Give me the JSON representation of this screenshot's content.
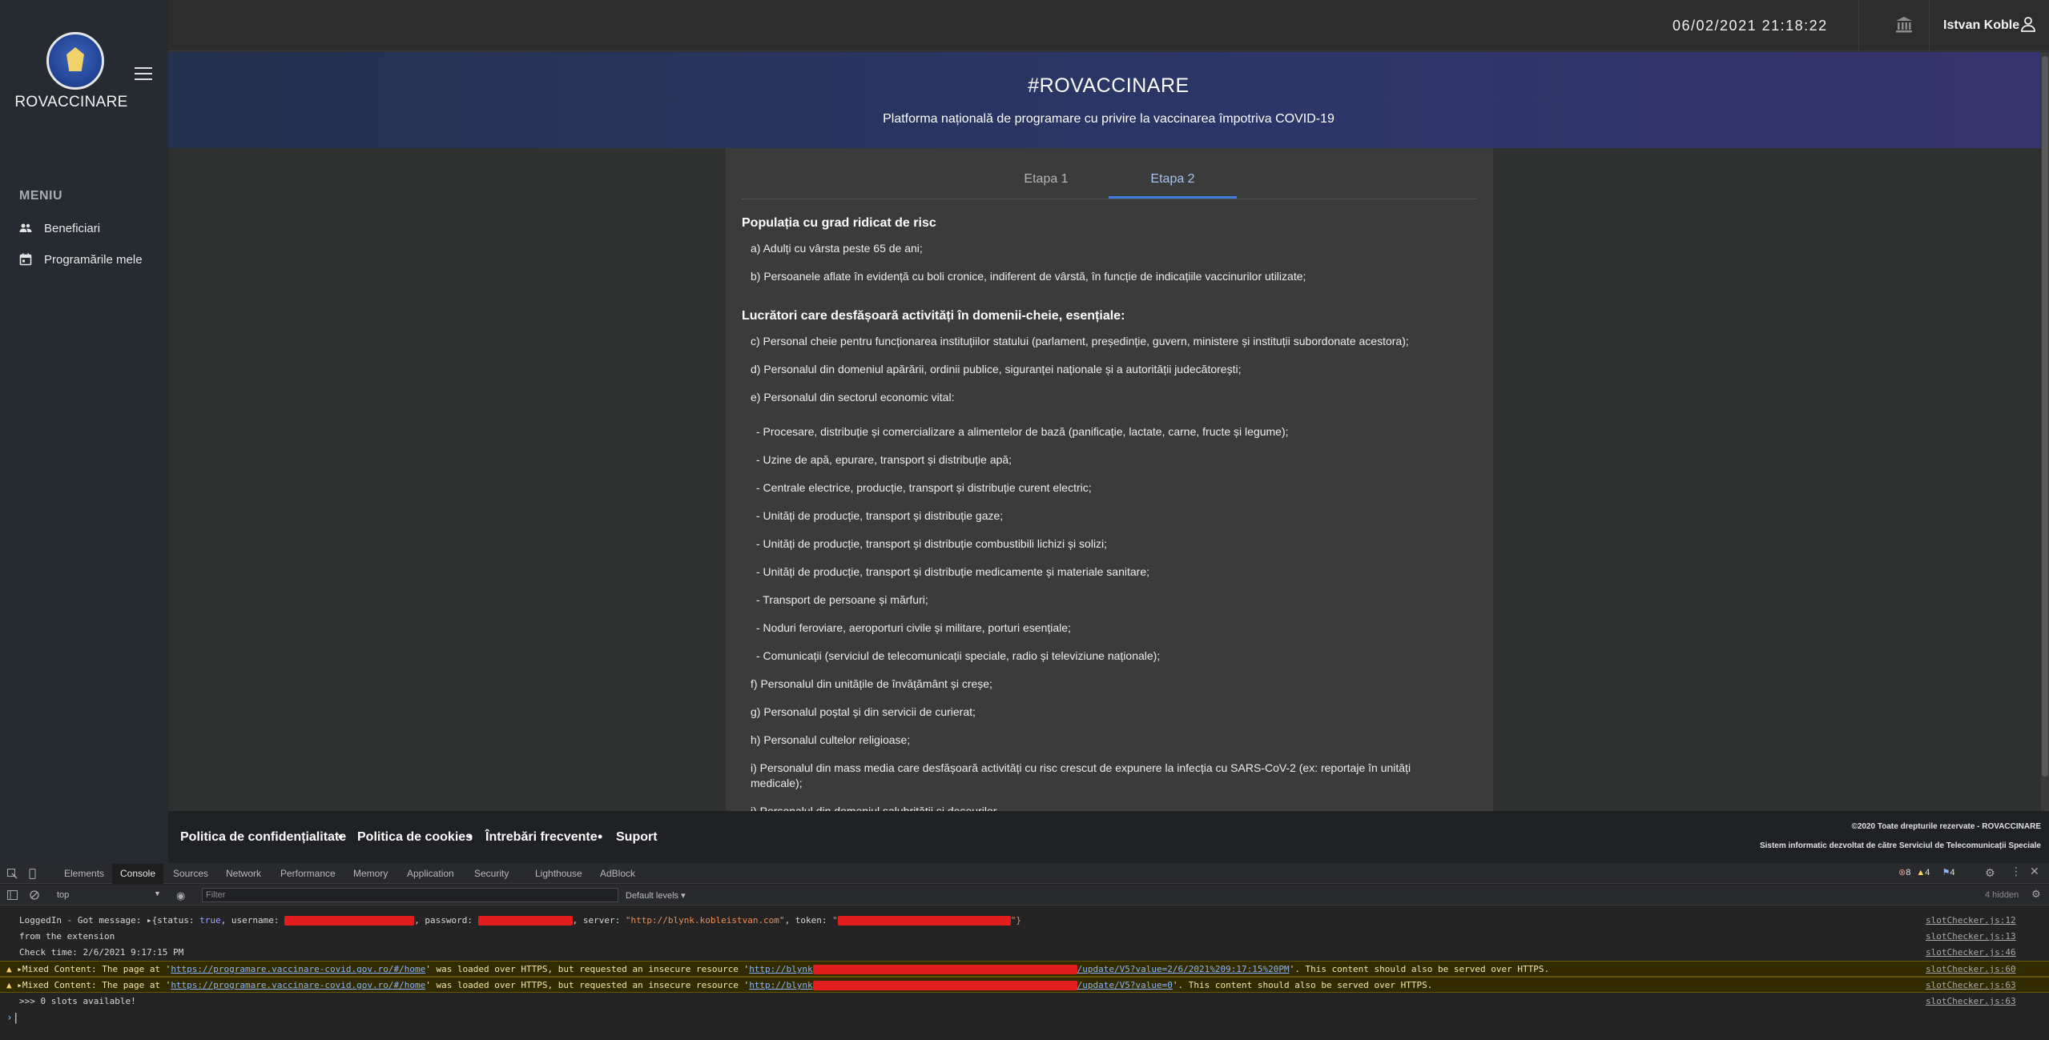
{
  "sidebar": {
    "brand": "ROVACCINARE",
    "menu_title": "MENIU",
    "items": [
      {
        "label": "Beneficiari",
        "icon": "users-icon"
      },
      {
        "label": "Programările mele",
        "icon": "calendar-icon"
      }
    ]
  },
  "topbar": {
    "datetime": "06/02/2021 21:18:22",
    "username": "Istvan Koble"
  },
  "banner": {
    "title": "#ROVACCINARE",
    "subtitle": "Platforma națională de programare cu privire la vaccinarea împotriva COVID-19"
  },
  "tabs": [
    {
      "label": "Etapa 1",
      "active": false
    },
    {
      "label": "Etapa 2",
      "active": true
    }
  ],
  "content": {
    "section1": "Populația cu grad ridicat de risc",
    "a": "a) Adulți cu vârsta peste 65 de ani;",
    "b": "b) Persoanele aflate în evidență cu boli cronice, indiferent de vârstă, în funcție de indicațiile vaccinurilor utilizate;",
    "section2": "Lucrători care desfășoară activități în domenii-cheie, esențiale:",
    "c": "c) Personal cheie pentru funcționarea instituțiilor statului (parlament, președinție, guvern, ministere și instituții subordonate acestora);",
    "d": "d) Personalul din domeniul apărării, ordinii publice, siguranței naționale și a autorității judecătorești;",
    "e": "e) Personalul din sectorul economic vital:",
    "e_items": [
      "- Procesare, distribuție și comercializare a alimentelor de bază (panificație, lactate, carne, fructe și legume);",
      "- Uzine de apă, epurare, transport și distribuție apă;",
      "- Centrale electrice, producție, transport și distribuție curent electric;",
      "- Unități de producție, transport și distribuție gaze;",
      "- Unități de producție, transport și distribuție combustibili lichizi și solizi;",
      "- Unități de producție, transport și distribuție medicamente și materiale sanitare;",
      "- Transport de persoane și mărfuri;",
      "- Noduri feroviare, aeroporturi civile și militare, porturi esențiale;",
      "- Comunicații (serviciul de telecomunicații speciale, radio și televiziune naționale);"
    ],
    "f": "f) Personalul din unitățile de învățământ și creșe;",
    "g": "g) Personalul poștal și din servicii de curierat;",
    "h": "h) Personalul cultelor religioase;",
    "i": "i) Personalul din mass media care desfășoară activități cu risc crescut de expunere la infecția cu SARS-CoV-2 (ex: reportaje în unități",
    "i2": "medicale);",
    "j": "j) Personalul din domeniul salubrității și deșeurilor"
  },
  "footer": {
    "links": [
      "Politica de confidențialitate",
      "Politica de cookies",
      "Întrebări frecvente",
      "Suport"
    ],
    "copyright": "©2020 Toate drepturile rezervate - ROVACCINARE",
    "developer": "Sistem informatic dezvoltat de către Serviciul de Telecomunicații Speciale"
  },
  "devtools": {
    "tabs": [
      "Elements",
      "Console",
      "Sources",
      "Network",
      "Performance",
      "Memory",
      "Application",
      "Security",
      "Lighthouse",
      "AdBlock"
    ],
    "context": "top",
    "filter_placeholder": "Filter",
    "levels": "Default levels ▾",
    "hidden": "4 hidden",
    "errors": "8",
    "warnings": "4",
    "info": "4",
    "logs": [
      {
        "text_a": "LoggedIn - Got message: ▸{status: ",
        "kw_true": "true",
        "text_b": ", username: ",
        "text_c": ", password: ",
        "text_d": ", server: ",
        "server": "\"http://blynk.kobleistvan.com\"",
        "text_e": ", token: ",
        "text_f": "\"",
        "text_g": "\"}",
        "src": "slotChecker.js:12"
      },
      {
        "text": "from the extension",
        "src": "slotChecker.js:13"
      },
      {
        "text": "Check time: 2/6/2021 9:17:15 PM",
        "src": "slotChecker.js:46"
      },
      {
        "pre": "▸Mixed Content: The page at '",
        "url": "https://programare.vaccinare-covid.gov.ro/#/home",
        "mid": "' was loaded over HTTPS, but requested an insecure resource '",
        "res_a": "http://blynk",
        "res_b": "/update/V5?value=2/6/2021%209:17:15%20PM",
        "post": "'. This content should also be served over HTTPS.",
        "src": "slotChecker.js:60"
      },
      {
        "pre": "▸Mixed Content: The page at '",
        "url": "https://programare.vaccinare-covid.gov.ro/#/home",
        "mid": "' was loaded over HTTPS, but requested an insecure resource '",
        "res_a": "http://blynk",
        "res_b": "/update/V5?value=0",
        "post": "'. This content should also be served over HTTPS.",
        "src": "slotChecker.js:63"
      },
      {
        "text": ">>> 0 slots available!",
        "src": "slotChecker.js:63"
      }
    ],
    "prompt": "›"
  },
  "colors": {
    "accent": "#3d7bd6",
    "sidebar_bg": "#262a31",
    "banner_start": "#23324e",
    "banner_end": "#36346e",
    "redaction": "#e11d1d"
  }
}
